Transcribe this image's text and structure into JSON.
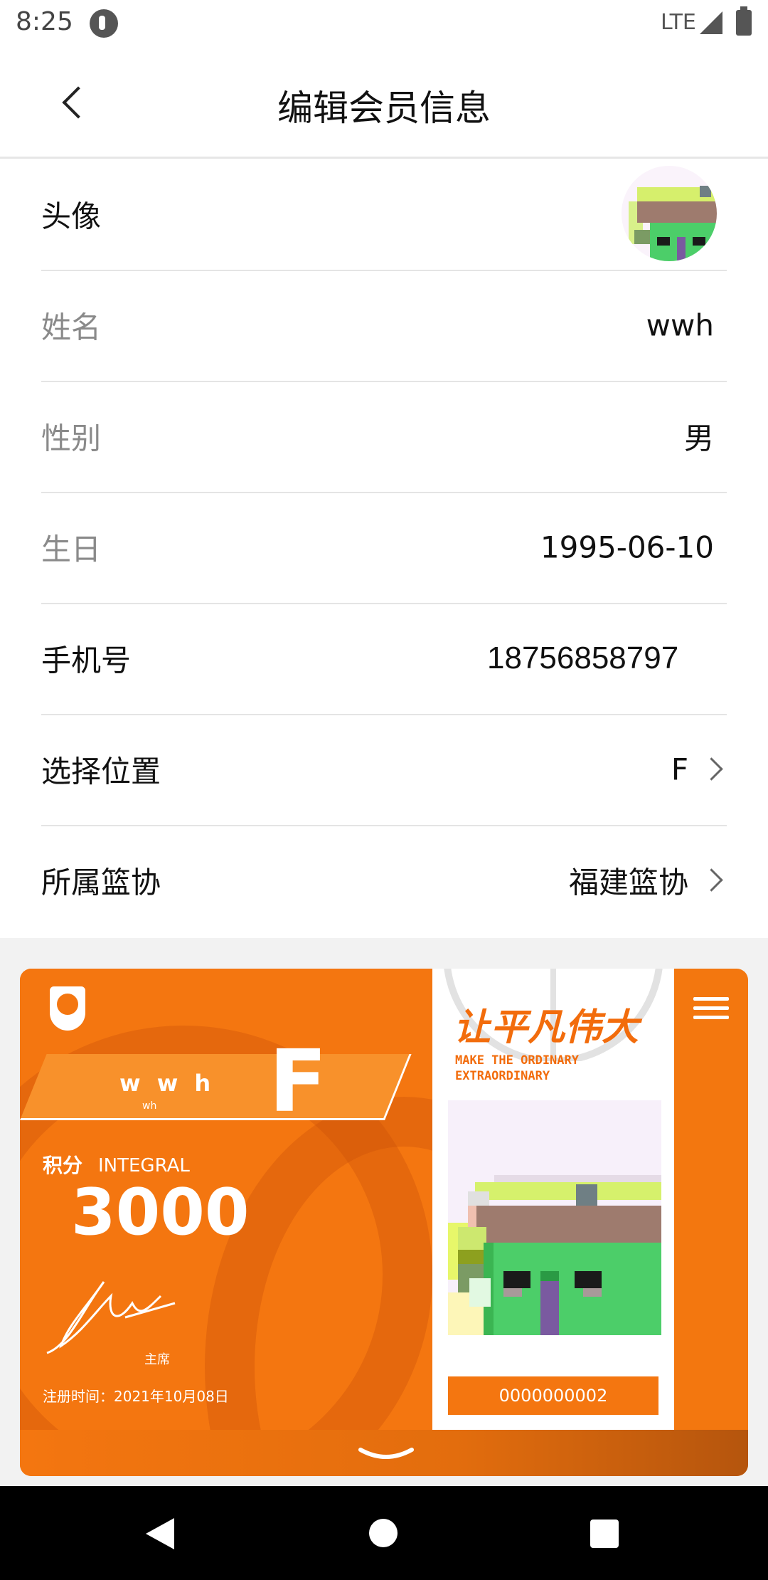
{
  "status_bar": {
    "time": "8:25",
    "network": "LTE",
    "icons": [
      "app-notification-icon",
      "signal-icon",
      "battery-icon"
    ]
  },
  "header": {
    "title": "编辑会员信息",
    "back_icon": "chevron-left-icon"
  },
  "form": {
    "avatar_label": "头像",
    "name_label": "姓名",
    "name_value": "wwh",
    "gender_label": "性别",
    "gender_value": "男",
    "birthday_label": "生日",
    "birthday_value": "1995-06-10",
    "phone_label": "手机号",
    "phone_value": "18756858797",
    "position_label": "选择位置",
    "position_value": "F",
    "association_label": "所属篮协",
    "association_value": "福建篮协"
  },
  "card": {
    "name": "w w h",
    "name_small": "wh",
    "position": "F",
    "integral_label": "积分",
    "integral_label_en": "INTEGRAL",
    "integral_value": "3000",
    "chairman_label": "主席",
    "register_text": "注册时间：2021年10月08日",
    "slogan": "让平凡伟大",
    "slogan_en_1": "MAKE THE ORDINARY",
    "slogan_en_2": "EXTRAORDINARY",
    "member_id": "0000000002",
    "icons": [
      "association-badge-icon",
      "menu-icon",
      "chevron-down-icon"
    ]
  },
  "colors": {
    "accent": "#f47610",
    "background": "#f2f2f2"
  },
  "nav": {
    "icons": [
      "back-triangle-icon",
      "home-circle-icon",
      "recents-square-icon"
    ]
  }
}
